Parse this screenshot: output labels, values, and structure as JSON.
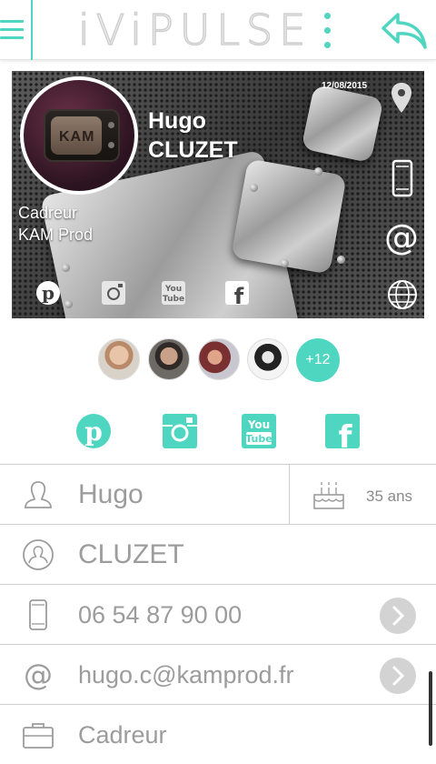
{
  "app": {
    "logo": "iViPULSE"
  },
  "colors": {
    "accent": "#4fd6c0",
    "text_muted": "#9c9c9c",
    "go_button": "#d3d3d3"
  },
  "header": {
    "menu_icon": "hamburger-icon",
    "more_icon": "kebab-menu-icon",
    "back_icon": "back-arrow-icon"
  },
  "card": {
    "first_name": "Hugo",
    "last_name": "CLUZET",
    "job": "Cadreur",
    "company": "KAM Prod",
    "date": "12/08/2015",
    "avatar_logo": "KAM",
    "side_icons": [
      "location-pin-icon",
      "mobile-phone-icon",
      "at-sign-icon",
      "globe-icon"
    ],
    "social_icons": [
      "pinterest-icon",
      "instagram-icon",
      "youtube-icon",
      "facebook-icon"
    ]
  },
  "friends": {
    "more_count": "+12"
  },
  "social_links": [
    "pinterest-icon",
    "instagram-icon",
    "youtube-icon",
    "facebook-icon"
  ],
  "profile": {
    "first_name": "Hugo",
    "age": "35 ans",
    "last_name": "CLUZET",
    "phone": "06 54 87 90 00",
    "email": "hugo.c@kamprod.fr",
    "job": "Cadreur"
  }
}
